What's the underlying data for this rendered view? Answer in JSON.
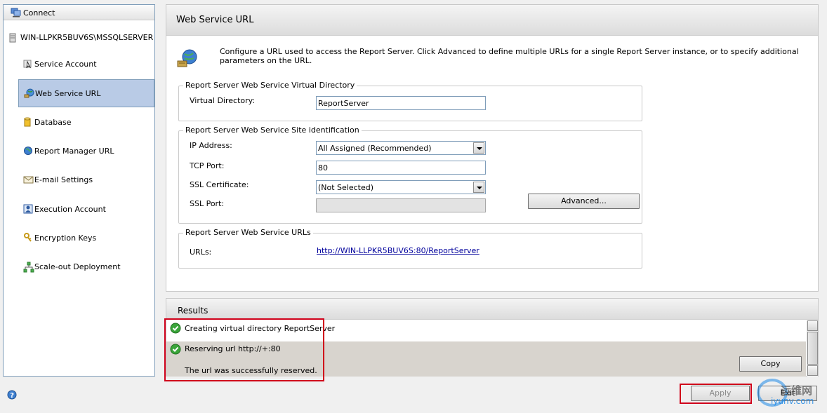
{
  "sidebar": {
    "connect_label": "Connect",
    "server_name": "WIN-LLPKR5BUV6S\\MSSQLSERVER",
    "items": [
      {
        "label": "Service Account",
        "icon": "service-account-icon"
      },
      {
        "label": "Web Service URL",
        "icon": "web-service-globe-icon",
        "selected": true
      },
      {
        "label": "Database",
        "icon": "database-icon"
      },
      {
        "label": "Report Manager URL",
        "icon": "globe-icon"
      },
      {
        "label": "E-mail Settings",
        "icon": "email-icon"
      },
      {
        "label": "Execution Account",
        "icon": "execution-account-icon"
      },
      {
        "label": "Encryption Keys",
        "icon": "keys-icon"
      },
      {
        "label": "Scale-out Deployment",
        "icon": "network-icon"
      }
    ]
  },
  "main": {
    "title": "Web Service URL",
    "description": "Configure a URL used to access the Report Server.  Click Advanced to define multiple URLs for a single Report Server instance, or to specify additional parameters on the URL.",
    "virtual_directory": {
      "group_title": "Report Server Web Service Virtual Directory",
      "label": "Virtual Directory:",
      "value": "ReportServer"
    },
    "site_identification": {
      "group_title": "Report Server Web Service Site identification",
      "ip_label": "IP Address:",
      "ip_value": "All Assigned (Recommended)",
      "tcp_label": "TCP Port:",
      "tcp_value": "80",
      "ssl_cert_label": "SSL Certificate:",
      "ssl_cert_value": "(Not Selected)",
      "ssl_port_label": "SSL Port:",
      "ssl_port_value": "",
      "advanced_label": "Advanced..."
    },
    "urls": {
      "group_title": "Report Server Web Service URLs",
      "label": "URLs:",
      "link": "http://WIN-LLPKR5BUV6S:80/ReportServer"
    }
  },
  "results": {
    "title": "Results",
    "rows": [
      {
        "text": "Creating virtual directory ReportServer",
        "status": "success"
      },
      {
        "text": "Reserving url http://+:80",
        "status": "success",
        "detail": "The url was successfully reserved."
      }
    ],
    "copy_label": "Copy"
  },
  "footer": {
    "apply_label": "Apply",
    "exit_label": "Exit",
    "help_icon": "help-icon"
  },
  "watermark": {
    "cn": "运维网",
    "url": "iyunv.com"
  },
  "colors": {
    "selection": "#b9cbe6",
    "highlight_box": "#d0021b",
    "link": "#00009c",
    "success": "#3aa53a"
  }
}
